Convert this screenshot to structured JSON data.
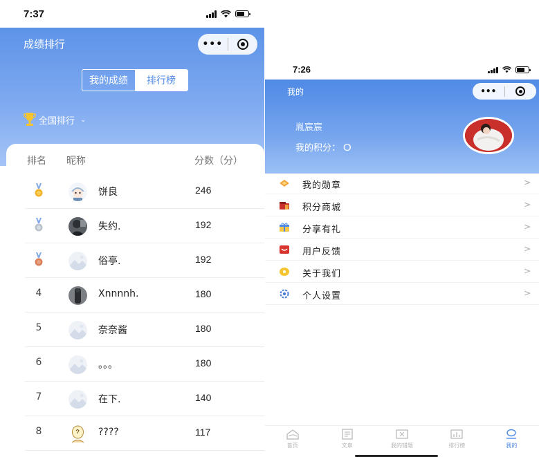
{
  "left": {
    "status": {
      "time": "7:37"
    },
    "header": {
      "title": "成绩排行",
      "capsule_dots": "•••"
    },
    "segment": {
      "my_scores": "我的成绩",
      "leaderboard": "排行榜",
      "active": "leaderboard"
    },
    "scope": {
      "label": "全国排行",
      "caret": "⌄"
    },
    "table": {
      "headers": {
        "rank": "排名",
        "nickname": "昵称",
        "score": "分数（分）"
      },
      "rows": [
        {
          "rank": "",
          "medal": "gold",
          "avatar": "cartoon-hat-avatar",
          "nickname": "饼良",
          "score": "246"
        },
        {
          "rank": "",
          "medal": "silver",
          "avatar": "photo-avatar",
          "nickname": "失约.",
          "score": "192"
        },
        {
          "rank": "",
          "medal": "bronze",
          "avatar": "placeholder-avatar",
          "nickname": "俗亭.",
          "score": "192"
        },
        {
          "rank": "4",
          "medal": "",
          "avatar": "photo-avatar",
          "nickname": "Xnnnnh.",
          "score": "180"
        },
        {
          "rank": "5",
          "medal": "",
          "avatar": "placeholder-avatar",
          "nickname": "奈奈酱",
          "score": "180"
        },
        {
          "rank": "6",
          "medal": "",
          "avatar": "placeholder-avatar",
          "nickname": "。。。",
          "score": "180"
        },
        {
          "rank": "7",
          "medal": "",
          "avatar": "placeholder-avatar",
          "nickname": "在下.",
          "score": "140"
        },
        {
          "rank": "8",
          "medal": "",
          "avatar": "sketch-avatar",
          "nickname": "????",
          "score": "117"
        }
      ]
    }
  },
  "right": {
    "status": {
      "time": "7:26"
    },
    "header": {
      "title": "我的",
      "capsule_dots": "•••",
      "username": "胤宸宸",
      "points_label": "我的积分：",
      "points_value": "O"
    },
    "menu": [
      {
        "label": "我的勋章",
        "icon": "medal-icon",
        "arrow": ">"
      },
      {
        "label": "积分商城",
        "icon": "shop-icon",
        "arrow": ">"
      },
      {
        "label": "分享有礼",
        "icon": "gift-icon",
        "arrow": ">"
      },
      {
        "label": "用户反馈",
        "icon": "feedback-icon",
        "arrow": ">"
      },
      {
        "label": "关于我们",
        "icon": "about-icon",
        "arrow": ">"
      },
      {
        "label": "个人设置",
        "icon": "settings-icon",
        "arrow": ">"
      }
    ],
    "tabbar": [
      {
        "label": "首页",
        "icon": "home-icon",
        "active": false
      },
      {
        "label": "文章",
        "icon": "article-icon",
        "active": false
      },
      {
        "label": "我的错题",
        "icon": "wrong-questions-icon",
        "active": false
      },
      {
        "label": "排行榜",
        "icon": "leaderboard-icon",
        "active": false
      },
      {
        "label": "我的",
        "icon": "profile-icon",
        "active": true
      }
    ]
  },
  "colors": {
    "brand_blue": "#4f8ae6",
    "header_light": "#a4c4f6",
    "gold": "#f2b32a",
    "silver": "#b9c2cc",
    "bronze": "#d9805a"
  }
}
